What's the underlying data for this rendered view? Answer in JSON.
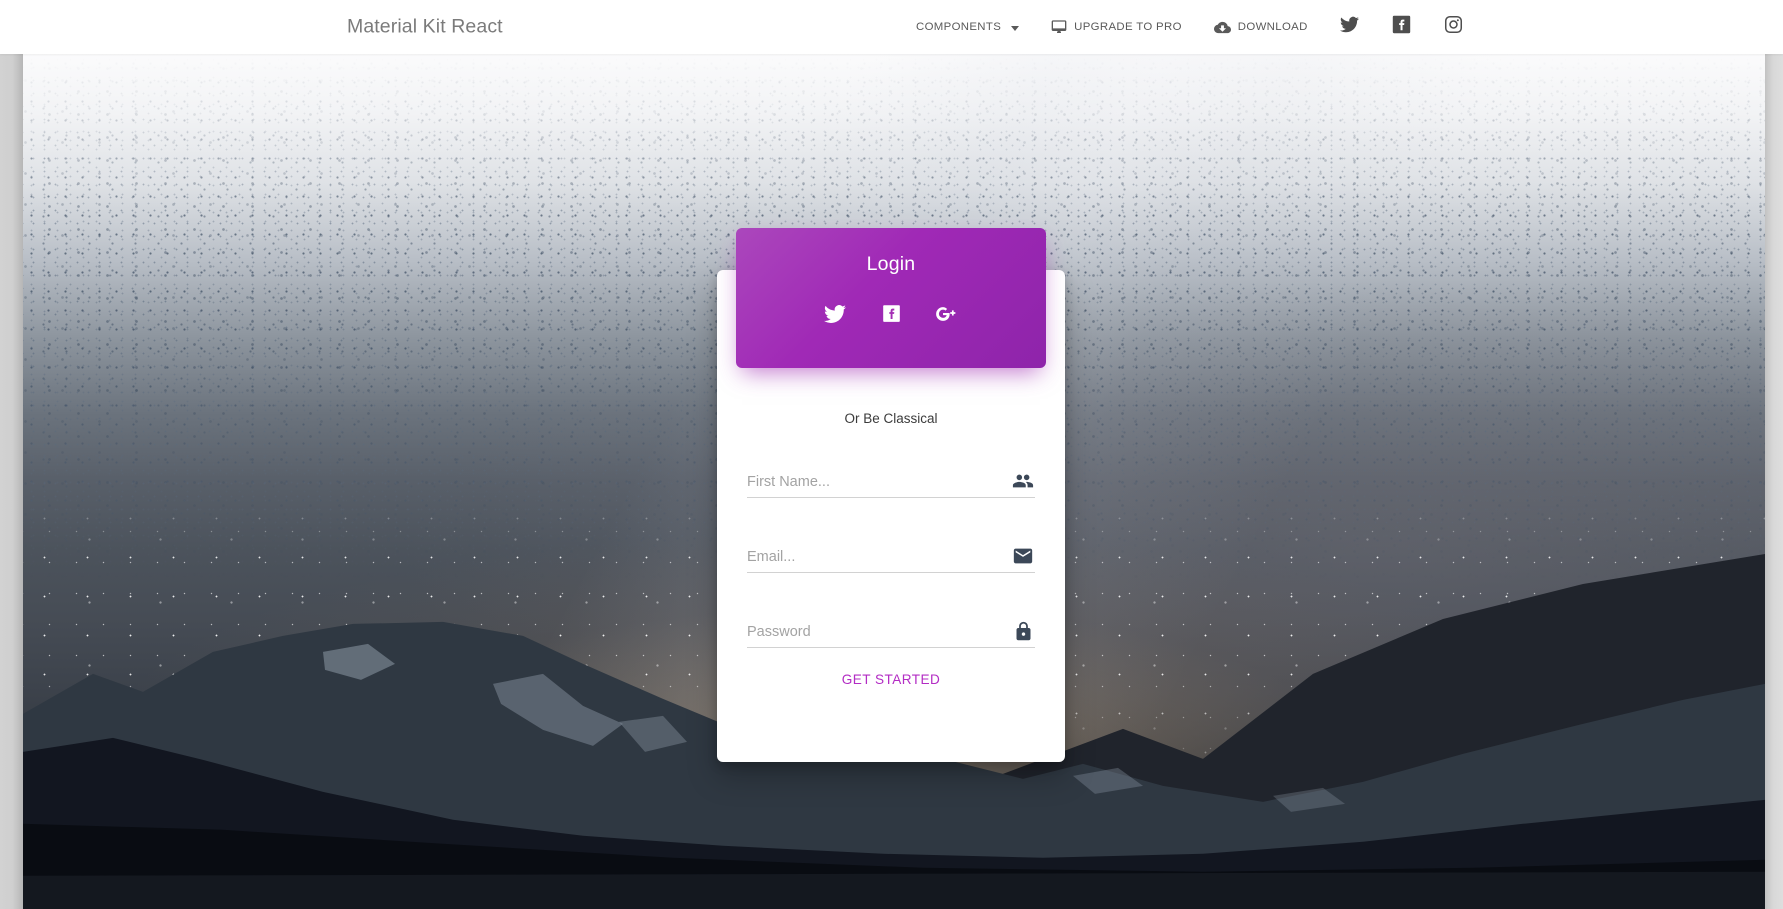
{
  "navbar": {
    "brand": "Material Kit React",
    "items": [
      {
        "label": "COMPONENTS",
        "icon": "chevron-down-icon",
        "has_caret": true
      },
      {
        "label": "UPGRADE TO PRO",
        "icon": "desktop-monitor-icon",
        "has_caret": false
      },
      {
        "label": "DOWNLOAD",
        "icon": "cloud-download-icon",
        "has_caret": false
      }
    ],
    "socials": [
      {
        "name": "twitter-icon",
        "label": "Twitter"
      },
      {
        "name": "facebook-icon",
        "label": "Facebook"
      },
      {
        "name": "instagram-icon",
        "label": "Instagram"
      }
    ]
  },
  "login_card": {
    "title": "Login",
    "social_buttons": [
      {
        "name": "twitter-icon",
        "label": "Twitter"
      },
      {
        "name": "facebook-icon",
        "label": "Facebook"
      },
      {
        "name": "google-plus-icon",
        "label": "Google Plus"
      }
    ],
    "divider_text": "Or Be Classical",
    "fields": [
      {
        "placeholder": "First Name...",
        "value": "",
        "icon": "people-icon",
        "type": "text"
      },
      {
        "placeholder": "Email...",
        "value": "",
        "icon": "email-icon",
        "type": "text"
      },
      {
        "placeholder": "Password",
        "value": "",
        "icon": "lock-icon",
        "type": "password"
      }
    ],
    "submit_label": "Get Started"
  },
  "colors": {
    "primary_purple": "#9c27b0",
    "header_gradient_start": "#ab47bc",
    "header_gradient_end": "#8e24aa",
    "link_purple": "#b32cc4",
    "nav_text": "#5a5a5a",
    "brand_text": "#7b7b7b",
    "card_background": "#ffffff",
    "placeholder": "#a3a3a3"
  },
  "background": {
    "description": "starry night sky over mountain lake"
  }
}
